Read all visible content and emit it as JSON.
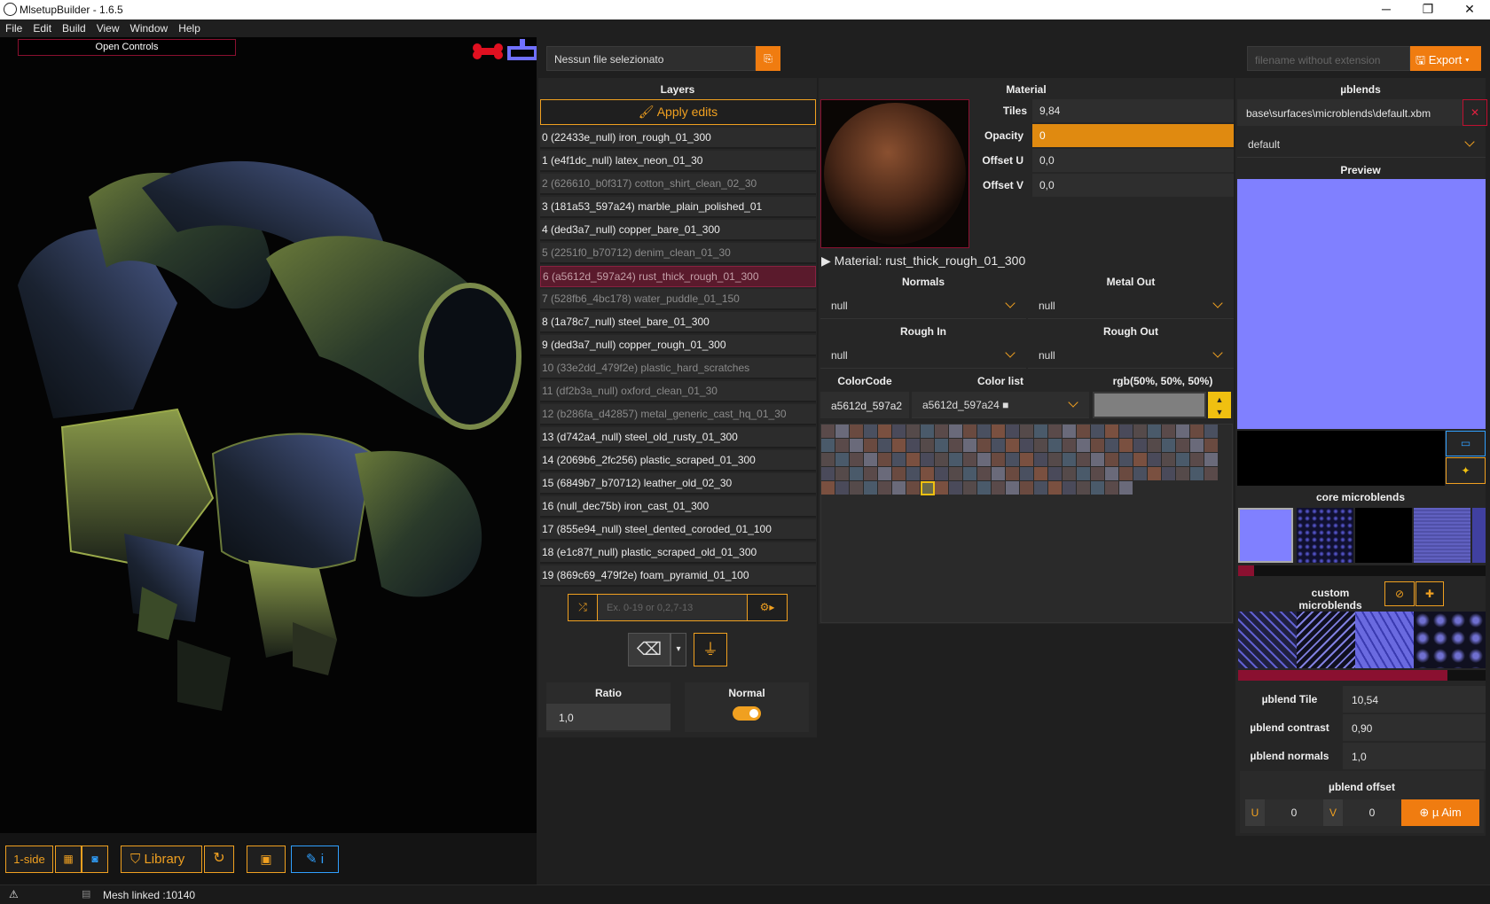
{
  "window": {
    "title": "MlsetupBuilder - 1.6.5",
    "controls": {
      "minimize": "─",
      "maximize": "❐",
      "close": "✕"
    }
  },
  "menu": [
    "File",
    "Edit",
    "Build",
    "View",
    "Window",
    "Help"
  ],
  "viewport": {
    "open_controls": "Open Controls"
  },
  "file": {
    "label": "Nessun file selezionato"
  },
  "export": {
    "placeholder": "filename without extension",
    "button": "Export"
  },
  "layers": {
    "title": "Layers",
    "apply": "Apply edits",
    "selected_index": 6,
    "items": [
      {
        "label": "0 (22433e_null) iron_rough_01_300",
        "dim": false
      },
      {
        "label": "1 (e4f1dc_null) latex_neon_01_30",
        "dim": false
      },
      {
        "label": "2 (626610_b0f317) cotton_shirt_clean_02_30",
        "dim": true
      },
      {
        "label": "3 (181a53_597a24) marble_plain_polished_01",
        "dim": false
      },
      {
        "label": "4 (ded3a7_null) copper_bare_01_300",
        "dim": false
      },
      {
        "label": "5 (2251f0_b70712) denim_clean_01_30",
        "dim": true
      },
      {
        "label": "6 (a5612d_597a24) rust_thick_rough_01_300",
        "dim": false
      },
      {
        "label": "7 (528fb6_4bc178) water_puddle_01_150",
        "dim": true
      },
      {
        "label": "8 (1a78c7_null) steel_bare_01_300",
        "dim": false
      },
      {
        "label": "9 (ded3a7_null) copper_rough_01_300",
        "dim": false
      },
      {
        "label": "10 (33e2dd_479f2e) plastic_hard_scratches",
        "dim": true
      },
      {
        "label": "11 (df2b3a_null) oxford_clean_01_30",
        "dim": true
      },
      {
        "label": "12 (b286fa_d42857) metal_generic_cast_hq_01_30",
        "dim": true
      },
      {
        "label": "13 (d742a4_null) steel_old_rusty_01_300",
        "dim": false
      },
      {
        "label": "14 (2069b6_2fc256) plastic_scraped_01_300",
        "dim": false
      },
      {
        "label": "15 (6849b7_b70712) leather_old_02_30",
        "dim": false
      },
      {
        "label": "16 (null_dec75b) iron_cast_01_300",
        "dim": false
      },
      {
        "label": "17 (855e94_null) steel_dented_coroded_01_100",
        "dim": false
      },
      {
        "label": "18 (e1c87f_null) plastic_scraped_old_01_300",
        "dim": false
      },
      {
        "label": "19 (869c69_479f2e) foam_pyramid_01_100",
        "dim": false
      }
    ],
    "range_placeholder": "Ex. 0-19 or 0,2,7-13",
    "ratio_label": "Ratio",
    "ratio_value": "1,0",
    "normal_label": "Normal",
    "normal_on": true
  },
  "material": {
    "title": "Material",
    "tiles_label": "Tiles",
    "tiles": "9,84",
    "opacity_label": "Opacity",
    "opacity": "0",
    "offu_label": "Offset U",
    "offu": "0,0",
    "offv_label": "Offset V",
    "offv": "0,0",
    "name_prefix": "Material:",
    "name": "rust_thick_rough_01_300",
    "normals_label": "Normals",
    "normals": "null",
    "metal_out_label": "Metal Out",
    "metal_out": "null",
    "rough_in_label": "Rough In",
    "rough_in": "null",
    "rough_out_label": "Rough Out",
    "rough_out": "null",
    "colorcode_label": "ColorCode",
    "colorcode": "a5612d_597a2",
    "colorlist_label": "Color list",
    "colorlist": "a5612d_597a24 ■",
    "rgb_label": "rgb(50%, 50%, 50%)",
    "rgb_swatch": "#7f7f7f"
  },
  "microblends": {
    "title": "µblends",
    "path": "base\\surfaces\\microblends\\default.xbm",
    "preset": "default",
    "preview_title": "Preview",
    "preview_color": "#8080ff",
    "core_title": "core microblends",
    "custom_title": "custom microblends",
    "tile_label": "µblend Tile",
    "tile": "10,54",
    "contrast_label": "µblend contrast",
    "contrast": "0,90",
    "normals_label": "µblend normals",
    "normals": "1,0",
    "offset_title": "µblend offset",
    "u_label": "U",
    "u": "0",
    "v_label": "V",
    "v": "0",
    "aim": "µ Aim"
  },
  "bottom": {
    "one_side": "1-side",
    "library": "Library"
  },
  "status": {
    "mesh": "Mesh linked :10140"
  },
  "colors": {
    "accent": "#f0a020",
    "selected": "#5a1a2c",
    "preview": "#8080ff"
  }
}
